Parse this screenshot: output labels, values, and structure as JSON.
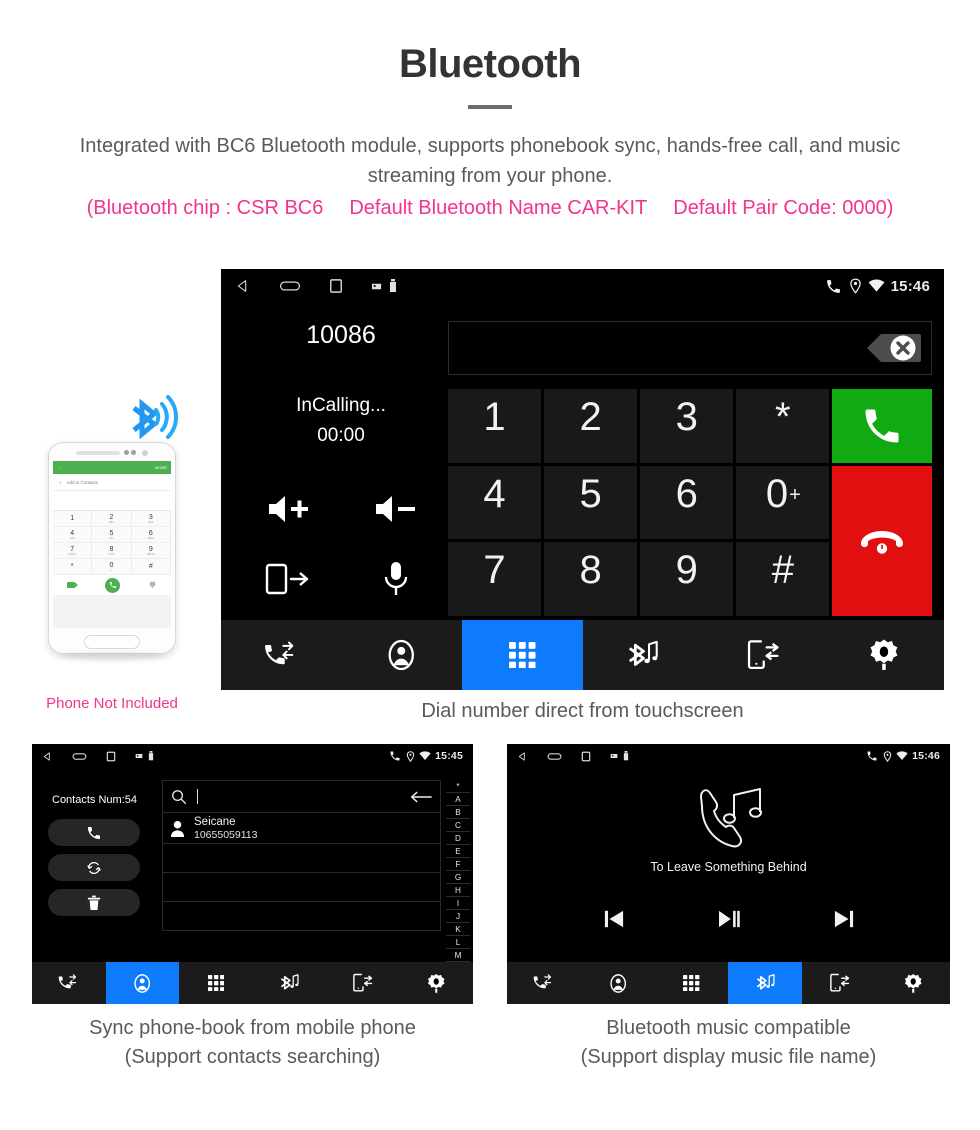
{
  "header": {
    "title": "Bluetooth",
    "intro": "Integrated with BC6 Bluetooth module, supports phonebook sync, hands-free call, and music streaming from your phone.",
    "spec_open": "(Bluetooth chip : CSR BC6",
    "spec_name": "Default Bluetooth Name CAR-KIT",
    "spec_code": "Default Pair Code: 0000)"
  },
  "phone_mock": {
    "not_included_label": "Phone Not Included",
    "appbar_more": "MORE",
    "add_to_contacts": "Add to Contacts",
    "keys": [
      {
        "d": "1",
        "s": ""
      },
      {
        "d": "2",
        "s": "ABC"
      },
      {
        "d": "3",
        "s": "DEF"
      },
      {
        "d": "4",
        "s": "GHI"
      },
      {
        "d": "5",
        "s": "JKL"
      },
      {
        "d": "6",
        "s": "MNO"
      },
      {
        "d": "7",
        "s": "PQRS"
      },
      {
        "d": "8",
        "s": "TUV"
      },
      {
        "d": "9",
        "s": "WXYZ"
      },
      {
        "d": "*",
        "s": ""
      },
      {
        "d": "0",
        "s": "+"
      },
      {
        "d": "#",
        "s": ""
      }
    ]
  },
  "dialer": {
    "statusbar": {
      "time": "15:46",
      "icons": [
        "back-icon",
        "home-icon",
        "recents-icon",
        "sd-card-icon",
        "usb-icon",
        "phone-icon",
        "location-icon",
        "wifi-icon"
      ]
    },
    "number_display": "10086",
    "call_state": "InCalling...",
    "call_timer": "00:00",
    "controls": [
      {
        "name": "volume-up-button",
        "label": "Volume Up"
      },
      {
        "name": "volume-down-button",
        "label": "Volume Down"
      },
      {
        "name": "transfer-to-phone-button",
        "label": "Transfer Audio"
      },
      {
        "name": "mute-microphone-button",
        "label": "Microphone"
      }
    ],
    "entry_value": "",
    "backspace_label": "Delete",
    "keys": [
      "1",
      "2",
      "3",
      "*",
      "4",
      "5",
      "6",
      "0",
      "7",
      "8",
      "9",
      "#"
    ],
    "key_zero_sub": "+",
    "call_button_label": "Call",
    "hangup_button_label": "Hang Up",
    "navbar": [
      {
        "name": "nav-call-log",
        "label": "Call Log",
        "active": false
      },
      {
        "name": "nav-contacts",
        "label": "Contacts",
        "active": false
      },
      {
        "name": "nav-keypad",
        "label": "Keypad",
        "active": true
      },
      {
        "name": "nav-bluetooth-music",
        "label": "Bluetooth Music",
        "active": false
      },
      {
        "name": "nav-device-connect",
        "label": "Device Connect",
        "active": false
      },
      {
        "name": "nav-settings",
        "label": "Settings",
        "active": false
      }
    ],
    "caption": "Dial number direct from touchscreen"
  },
  "contacts": {
    "statusbar": {
      "time": "15:45"
    },
    "contacts_num_label": "Contacts Num:54",
    "actions": [
      {
        "name": "dial-contact-button",
        "label": "Call"
      },
      {
        "name": "sync-contacts-button",
        "label": "Sync"
      },
      {
        "name": "delete-contacts-button",
        "label": "Delete"
      }
    ],
    "search_value": "",
    "search_placeholder": "",
    "rows": [
      {
        "name": "Seicane",
        "number": "10655059113"
      }
    ],
    "empty_row_count": 3,
    "alpha_index": [
      "*",
      "A",
      "B",
      "C",
      "D",
      "E",
      "F",
      "G",
      "H",
      "I",
      "J",
      "K",
      "L",
      "M"
    ],
    "navbar": [
      {
        "name": "nav-call-log",
        "label": "Call Log",
        "active": false
      },
      {
        "name": "nav-contacts",
        "label": "Contacts",
        "active": true
      },
      {
        "name": "nav-keypad",
        "label": "Keypad",
        "active": false
      },
      {
        "name": "nav-bluetooth-music",
        "label": "Bluetooth Music",
        "active": false
      },
      {
        "name": "nav-device-connect",
        "label": "Device Connect",
        "active": false
      },
      {
        "name": "nav-settings",
        "label": "Settings",
        "active": false
      }
    ],
    "caption_line1": "Sync phone-book from mobile phone",
    "caption_line2": "(Support contacts searching)"
  },
  "music": {
    "statusbar": {
      "time": "15:46"
    },
    "track_title": "To Leave Something Behind",
    "controls": [
      {
        "name": "previous-track-button",
        "label": "Previous"
      },
      {
        "name": "play-pause-button",
        "label": "Play / Pause"
      },
      {
        "name": "next-track-button",
        "label": "Next"
      }
    ],
    "navbar": [
      {
        "name": "nav-call-log",
        "label": "Call Log",
        "active": false
      },
      {
        "name": "nav-contacts",
        "label": "Contacts",
        "active": false
      },
      {
        "name": "nav-keypad",
        "label": "Keypad",
        "active": false
      },
      {
        "name": "nav-bluetooth-music",
        "label": "Bluetooth Music",
        "active": true
      },
      {
        "name": "nav-device-connect",
        "label": "Device Connect",
        "active": false
      },
      {
        "name": "nav-settings",
        "label": "Settings",
        "active": false
      }
    ],
    "caption_line1": "Bluetooth music compatible",
    "caption_line2": "(Support display music file name)"
  },
  "colors": {
    "accent_pink": "#f2348a",
    "nav_active_blue": "#0d7bfc",
    "call_green": "#12aa12",
    "hangup_red": "#e10f0f",
    "screen_black": "#000000"
  }
}
